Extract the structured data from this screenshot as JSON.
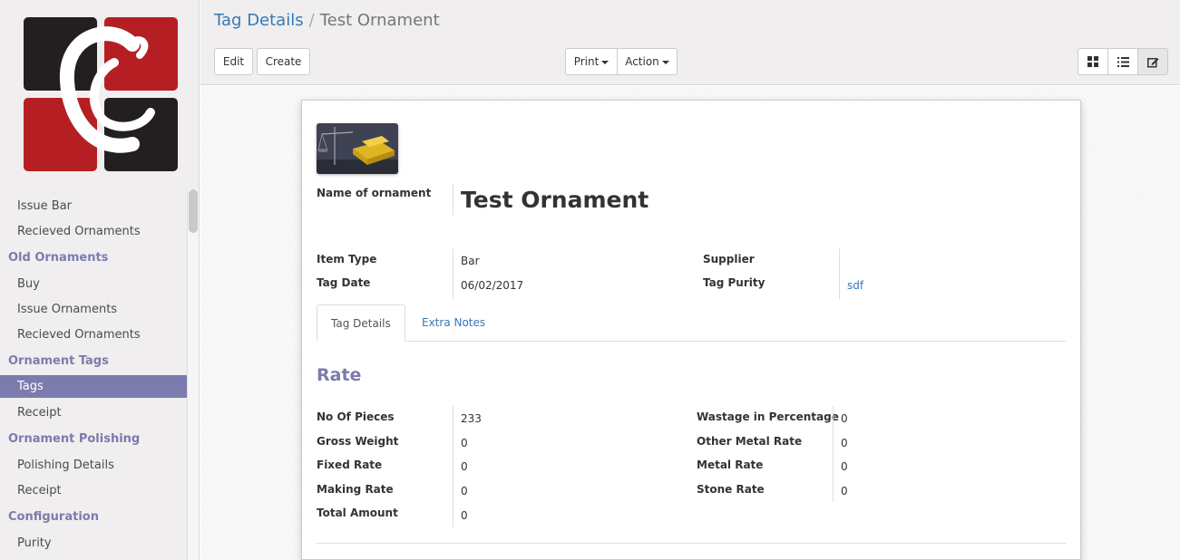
{
  "sidebar": {
    "items": [
      {
        "type": "item",
        "label": "Issue Bar"
      },
      {
        "type": "item",
        "label": "Recieved Ornaments"
      },
      {
        "type": "header",
        "label": "Old Ornaments"
      },
      {
        "type": "item",
        "label": "Buy"
      },
      {
        "type": "item",
        "label": "Issue Ornaments"
      },
      {
        "type": "item",
        "label": "Recieved Ornaments"
      },
      {
        "type": "header",
        "label": "Ornament Tags"
      },
      {
        "type": "item",
        "label": "Tags",
        "active": true
      },
      {
        "type": "item",
        "label": "Receipt"
      },
      {
        "type": "header",
        "label": "Ornament Polishing"
      },
      {
        "type": "item",
        "label": "Polishing Details"
      },
      {
        "type": "item",
        "label": "Receipt"
      },
      {
        "type": "header",
        "label": "Configuration"
      },
      {
        "type": "item",
        "label": "Purity"
      }
    ],
    "accent": "#7c7bad"
  },
  "breadcrumb": {
    "parent": "Tag Details",
    "separator": "/",
    "current": "Test Ornament"
  },
  "toolbar": {
    "edit": "Edit",
    "create": "Create",
    "print": "Print",
    "action": "Action",
    "views": [
      "kanban-icon",
      "list-icon",
      "form-icon"
    ]
  },
  "form": {
    "name_label": "Name of ornament",
    "name_value": "Test Ornament",
    "item_type_label": "Item Type",
    "item_type_value": "Bar",
    "tag_date_label": "Tag Date",
    "tag_date_value": "06/02/2017",
    "supplier_label": "Supplier",
    "supplier_value": "",
    "tag_purity_label": "Tag Purity",
    "tag_purity_value": "sdf",
    "tabs": [
      {
        "label": "Tag Details",
        "active": true
      },
      {
        "label": "Extra Notes",
        "active": false
      }
    ],
    "section_title": "Rate",
    "left_fields": [
      {
        "label": "No Of Pieces",
        "value": "233"
      },
      {
        "label": "Gross Weight",
        "value": "0"
      },
      {
        "label": "Fixed Rate",
        "value": "0"
      },
      {
        "label": "Making Rate",
        "value": "0"
      },
      {
        "label": "Total Amount",
        "value": "0"
      }
    ],
    "right_fields": [
      {
        "label": "Wastage in Percentage",
        "value": "0"
      },
      {
        "label": "Other Metal Rate",
        "value": "0"
      },
      {
        "label": "Metal Rate",
        "value": "0"
      },
      {
        "label": "Stone Rate",
        "value": "0"
      }
    ]
  }
}
